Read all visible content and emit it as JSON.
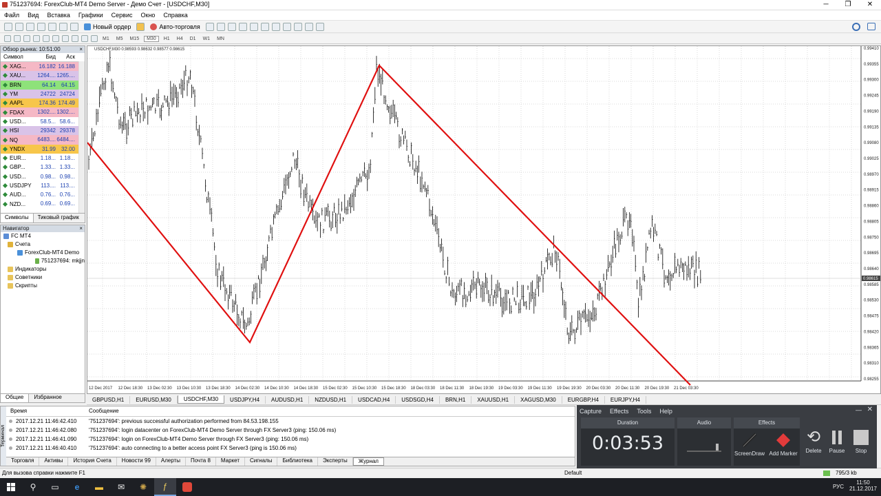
{
  "window": {
    "title": "751237694: ForexClub-MT4 Demo Server - Демо Счет - [USDCHF,M30]",
    "buttons": [
      "─",
      "❐",
      "✕"
    ]
  },
  "menu": [
    "Файл",
    "Вид",
    "Вставка",
    "Графики",
    "Сервис",
    "Окно",
    "Справка"
  ],
  "toolbar": {
    "new_order": "Новый ордер",
    "autotrading": "Авто-торговля"
  },
  "timeframes": [
    "M1",
    "M5",
    "M15",
    "M30",
    "H1",
    "H4",
    "D1",
    "W1",
    "MN"
  ],
  "active_timeframe": "M30",
  "market_watch": {
    "title": "Обзор рынка: 10:51:00",
    "columns": [
      "Символ",
      "Бид",
      "Аск"
    ],
    "rows": [
      {
        "sym": "XAG...",
        "bid": "16.182",
        "ask": "16.188",
        "bg": "#f5b8c5"
      },
      {
        "sym": "XAU...",
        "bid": "1264....",
        "ask": "1265....",
        "bg": "#d9c3e8"
      },
      {
        "sym": "BRN",
        "bid": "64.14",
        "ask": "64.15",
        "bg": "#8ee27a"
      },
      {
        "sym": "YM",
        "bid": "24722",
        "ask": "24724",
        "bg": "#d9c3e8"
      },
      {
        "sym": "AAPL",
        "bid": "174.36",
        "ask": "174.49",
        "bg": "#f7c64a"
      },
      {
        "sym": "FDAX",
        "bid": "1302....",
        "ask": "1302....",
        "bg": "#f5b8c5"
      },
      {
        "sym": "USD...",
        "bid": "58.5...",
        "ask": "58.6...",
        "bg": "#ffffff"
      },
      {
        "sym": "HSI",
        "bid": "29342",
        "ask": "29378",
        "bg": "#d9c3e8"
      },
      {
        "sym": "NQ",
        "bid": "6483....",
        "ask": "6484....",
        "bg": "#f5b8c5"
      },
      {
        "sym": "YNDX",
        "bid": "31.99",
        "ask": "32.00",
        "bg": "#f7c64a"
      },
      {
        "sym": "EUR...",
        "bid": "1.18...",
        "ask": "1.18...",
        "bg": "#ffffff"
      },
      {
        "sym": "GBP...",
        "bid": "1.33...",
        "ask": "1.33...",
        "bg": "#ffffff"
      },
      {
        "sym": "USD...",
        "bid": "0.98...",
        "ask": "0.98...",
        "bg": "#ffffff"
      },
      {
        "sym": "USDJPY",
        "bid": "113....",
        "ask": "113....",
        "bg": "#ffffff"
      },
      {
        "sym": "AUD...",
        "bid": "0.76...",
        "ask": "0.76...",
        "bg": "#ffffff"
      },
      {
        "sym": "NZD...",
        "bid": "0.69...",
        "ask": "0.69...",
        "bg": "#ffffff"
      }
    ],
    "tabs": [
      "Символы",
      "Тиковый график"
    ]
  },
  "navigator": {
    "title": "Навигатор",
    "items": [
      "FC MT4",
      "Счета",
      "ForexClub-MT4 Demo",
      "751237694: mkjjn",
      "Индикаторы",
      "Советники",
      "Скрипты"
    ],
    "tabs": [
      "Общие",
      "Избранное"
    ]
  },
  "chart": {
    "label": "USDCHF,M30  0.98593 0.98632 0.98577 0.98615",
    "current_price": "0.98615",
    "price_labels": [
      "0.99410",
      "0.99355",
      "0.99300",
      "0.99245",
      "0.99190",
      "0.99135",
      "0.99080",
      "0.99025",
      "0.98970",
      "0.98915",
      "0.98860",
      "0.98805",
      "0.98750",
      "0.98695",
      "0.98640",
      "0.98585",
      "0.98530",
      "0.98475",
      "0.98420",
      "0.98365",
      "0.98310",
      "0.98255"
    ],
    "time_labels": [
      "12 Dec 2017",
      "12 Dec 18:30",
      "13 Dec 02:30",
      "13 Dec 10:30",
      "13 Dec 18:30",
      "14 Dec 02:30",
      "14 Dec 10:30",
      "14 Dec 18:30",
      "15 Dec 02:30",
      "15 Dec 10:30",
      "15 Dec 18:30",
      "18 Dec 03:30",
      "18 Dec 11:30",
      "18 Dec 19:30",
      "19 Dec 03:30",
      "19 Dec 11:30",
      "19 Dec 19:30",
      "20 Dec 03:30",
      "20 Dec 11:30",
      "20 Dec 19:30",
      "21 Dec 03:30"
    ]
  },
  "chart_tabs": [
    "GBPUSD,H1",
    "EURUSD,M30",
    "USDCHF,M30",
    "USDJPY,H4",
    "AUDUSD,H1",
    "NZDUSD,H1",
    "USDCAD,H4",
    "USDSGD,H4",
    "BRN,H1",
    "XAUUSD,H1",
    "XAGUSD,M30",
    "EURGBP,H4",
    "EURJPY,H4"
  ],
  "active_chart_tab": "USDCHF,M30",
  "terminal": {
    "side_label": "Терминал",
    "columns": [
      "Время",
      "Сообщение"
    ],
    "rows": [
      {
        "time": "2017.12.21 11:46:42.410",
        "msg": "'751237694': previous successful authorization performed from 84.53.198.155"
      },
      {
        "time": "2017.12.21 11:46:42.080",
        "msg": "'751237694': login datacenter on ForexClub-MT4 Demo Server through FX Server3 (ping: 150.06 ms)"
      },
      {
        "time": "2017.12.21 11:46:41.090",
        "msg": "'751237694': login on ForexClub-MT4 Demo Server through FX Server3 (ping: 150.06 ms)"
      },
      {
        "time": "2017.12.21 11:46:40.410",
        "msg": "'751237694': auto connecting to a better access point FX Server3 (ping is 150.06 ms)"
      }
    ],
    "tabs": [
      "Торговля",
      "Активы",
      "История Счета",
      "Новости 99",
      "Алерты",
      "Почта 8",
      "Маркет",
      "Сигналы",
      "Библиотека",
      "Эксперты",
      "Журнал"
    ],
    "active_tab": "Журнал"
  },
  "status": {
    "help": "Для вызова справки нажмите F1",
    "profile": "Default",
    "traffic": "795/3 kb"
  },
  "capture": {
    "menu": [
      "Capture",
      "Effects",
      "Tools",
      "Help"
    ],
    "duration_label": "Duration",
    "duration": "0:03:53",
    "audio_label": "Audio",
    "effects_label": "Effects",
    "buttons": [
      "ScreenDraw",
      "Add Marker",
      "Delete",
      "Pause",
      "Stop"
    ]
  },
  "taskbar": {
    "lang": "РУС",
    "time": "11:50",
    "date": "21.12.2017"
  }
}
